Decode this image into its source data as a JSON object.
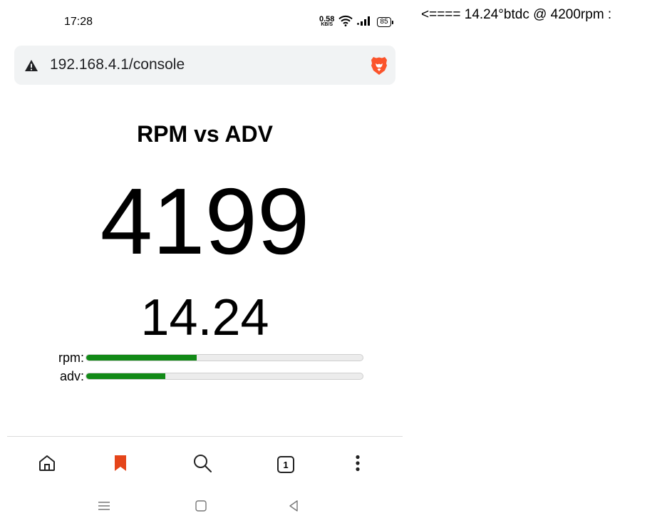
{
  "status_bar": {
    "time": "17:28",
    "speed_value": "0.58",
    "speed_unit": "KB/S",
    "battery": "85"
  },
  "browser": {
    "url": "192.168.4.1/console",
    "security_icon": "warning-triangle-icon",
    "brand_icon": "brave-lion-icon",
    "brand_color": "#fb542b"
  },
  "console": {
    "title": "RPM vs ADV",
    "rpm_value": "4199",
    "adv_value": "14.24",
    "meters": [
      {
        "label": "rpm:",
        "fraction": 0.4
      },
      {
        "label": "adv:",
        "fraction": 0.285
      }
    ],
    "meter_color": "#128a17"
  },
  "bottom_nav": {
    "icons": [
      "home-icon",
      "bookmark-icon",
      "search-icon",
      "tabs-icon",
      "more-icon"
    ],
    "tab_count": "1",
    "bookmark_color": "#e5451a"
  },
  "system_nav": {
    "icons": [
      "menu-icon",
      "home-square-icon",
      "back-icon"
    ]
  },
  "annotation": {
    "text": "<==== 14.24°btdc @ 4200rpm :"
  }
}
